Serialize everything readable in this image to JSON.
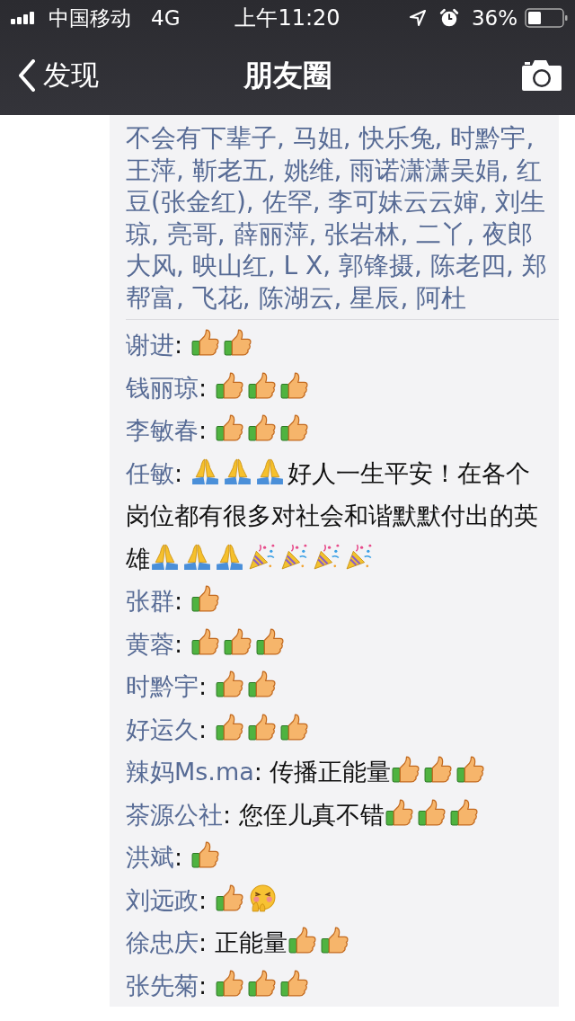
{
  "status_bar": {
    "carrier": "中国移动",
    "network": "4G",
    "time": "上午11:20",
    "battery": "36%"
  },
  "nav": {
    "back": "发现",
    "title": "朋友圈"
  },
  "likes": "不会有下辈子, 马姐, 快乐兔, 时黔宇, 王萍, 靳老五, 姚维, 雨诺潇潇吴娟, 红豆(张金红), 佐罕, 李可妹云云婶, 刘生琼, 亮哥, 薛丽萍, 张岩林, 二丫, 夜郎大风, 映山红, L X, 郭锋摄, 陈老四, 郑帮富, 飞花, 陈湖云, 星辰, 阿杜",
  "comments": [
    {
      "name": "谢进",
      "parts": [
        {
          "kind": "text",
          "text": ": "
        },
        {
          "kind": "thumbs-up"
        },
        {
          "kind": "thumbs-up"
        }
      ]
    },
    {
      "name": "钱丽琼",
      "parts": [
        {
          "kind": "text",
          "text": ": "
        },
        {
          "kind": "thumbs-up"
        },
        {
          "kind": "thumbs-up"
        },
        {
          "kind": "thumbs-up"
        }
      ]
    },
    {
      "name": "李敏春",
      "parts": [
        {
          "kind": "text",
          "text": ": "
        },
        {
          "kind": "thumbs-up"
        },
        {
          "kind": "thumbs-up"
        },
        {
          "kind": "thumbs-up"
        }
      ]
    },
    {
      "name": "任敏",
      "parts": [
        {
          "kind": "text",
          "text": ": "
        },
        {
          "kind": "pray"
        },
        {
          "kind": "pray"
        },
        {
          "kind": "pray"
        },
        {
          "kind": "text",
          "text": "好人一生平安！在各个岗位都有很多对社会和谐默默付出的英雄"
        },
        {
          "kind": "pray"
        },
        {
          "kind": "pray"
        },
        {
          "kind": "pray"
        },
        {
          "kind": "party"
        },
        {
          "kind": "party"
        },
        {
          "kind": "party"
        },
        {
          "kind": "party"
        }
      ]
    },
    {
      "name": "张群",
      "parts": [
        {
          "kind": "text",
          "text": ": "
        },
        {
          "kind": "thumbs-up"
        }
      ]
    },
    {
      "name": "黄蓉",
      "parts": [
        {
          "kind": "text",
          "text": ": "
        },
        {
          "kind": "thumbs-up"
        },
        {
          "kind": "thumbs-up"
        },
        {
          "kind": "thumbs-up"
        }
      ]
    },
    {
      "name": "时黔宇",
      "parts": [
        {
          "kind": "text",
          "text": ": "
        },
        {
          "kind": "thumbs-up"
        },
        {
          "kind": "thumbs-up"
        }
      ]
    },
    {
      "name": "好运久",
      "parts": [
        {
          "kind": "text",
          "text": ": "
        },
        {
          "kind": "thumbs-up"
        },
        {
          "kind": "thumbs-up"
        },
        {
          "kind": "thumbs-up"
        }
      ]
    },
    {
      "name": "辣妈Ms.ma",
      "parts": [
        {
          "kind": "text",
          "text": ": 传播正能量"
        },
        {
          "kind": "thumbs-up"
        },
        {
          "kind": "thumbs-up"
        },
        {
          "kind": "thumbs-up"
        }
      ]
    },
    {
      "name": "茶源公社",
      "parts": [
        {
          "kind": "text",
          "text": ": 您侄儿真不错"
        },
        {
          "kind": "thumbs-up"
        },
        {
          "kind": "thumbs-up"
        },
        {
          "kind": "thumbs-up"
        }
      ]
    },
    {
      "name": "洪斌",
      "parts": [
        {
          "kind": "text",
          "text": ": "
        },
        {
          "kind": "thumbs-up"
        }
      ]
    },
    {
      "name": "刘远政",
      "parts": [
        {
          "kind": "text",
          "text": ": "
        },
        {
          "kind": "thumbs-up"
        },
        {
          "kind": "hug"
        }
      ]
    },
    {
      "name": "徐忠庆",
      "parts": [
        {
          "kind": "text",
          "text": ": 正能量"
        },
        {
          "kind": "thumbs-up"
        },
        {
          "kind": "thumbs-up"
        }
      ]
    },
    {
      "name": "张先菊",
      "parts": [
        {
          "kind": "text",
          "text": ": "
        },
        {
          "kind": "thumbs-up"
        },
        {
          "kind": "thumbs-up"
        },
        {
          "kind": "thumbs-up"
        }
      ]
    }
  ]
}
